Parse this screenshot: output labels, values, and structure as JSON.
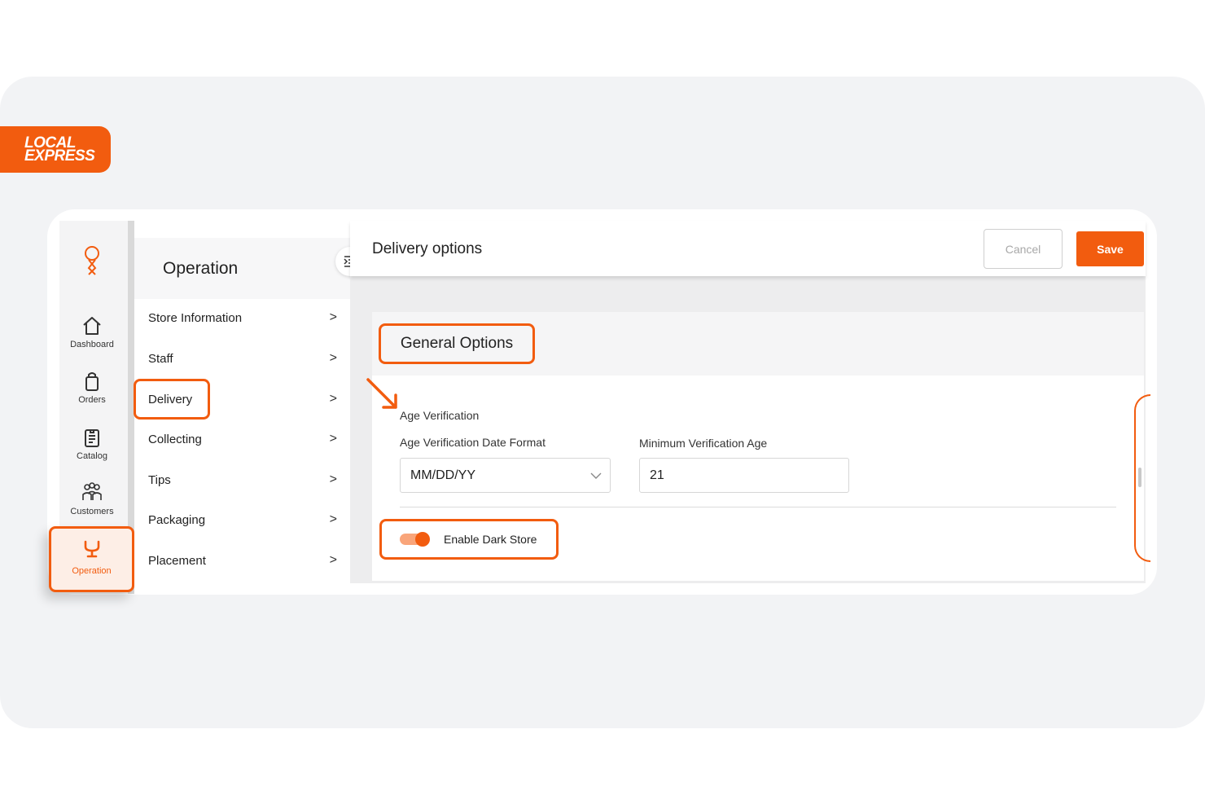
{
  "brand": {
    "line1": "LOCAL",
    "line2": "EXPRESS"
  },
  "rail": {
    "items": [
      {
        "label": "Dashboard",
        "icon": "home-icon"
      },
      {
        "label": "Orders",
        "icon": "shopping-bag-icon"
      },
      {
        "label": "Catalog",
        "icon": "clipboard-icon"
      },
      {
        "label": "Customers",
        "icon": "users-icon"
      }
    ],
    "active": {
      "label": "Operation",
      "icon": "wrench-icon"
    }
  },
  "submenu": {
    "title": "Operation",
    "items": [
      {
        "label": "Store Information"
      },
      {
        "label": "Staff"
      },
      {
        "label": "Delivery"
      },
      {
        "label": "Collecting"
      },
      {
        "label": "Tips"
      },
      {
        "label": "Packaging"
      },
      {
        "label": "Placement"
      }
    ],
    "chevron": ">"
  },
  "header": {
    "title": "Delivery options",
    "cancel_label": "Cancel",
    "save_label": "Save"
  },
  "panel": {
    "section_title": "General Options",
    "age_verification_label": "Age Verification",
    "date_format_label": "Age Verification Date Format",
    "date_format_value": "MM/DD/YY",
    "min_age_label": "Minimum Verification Age",
    "min_age_value": "21",
    "dark_store_label": "Enable Dark Store",
    "dark_store_enabled": true
  },
  "colors": {
    "accent": "#f25c0f",
    "page_bg": "#f2f3f5"
  }
}
